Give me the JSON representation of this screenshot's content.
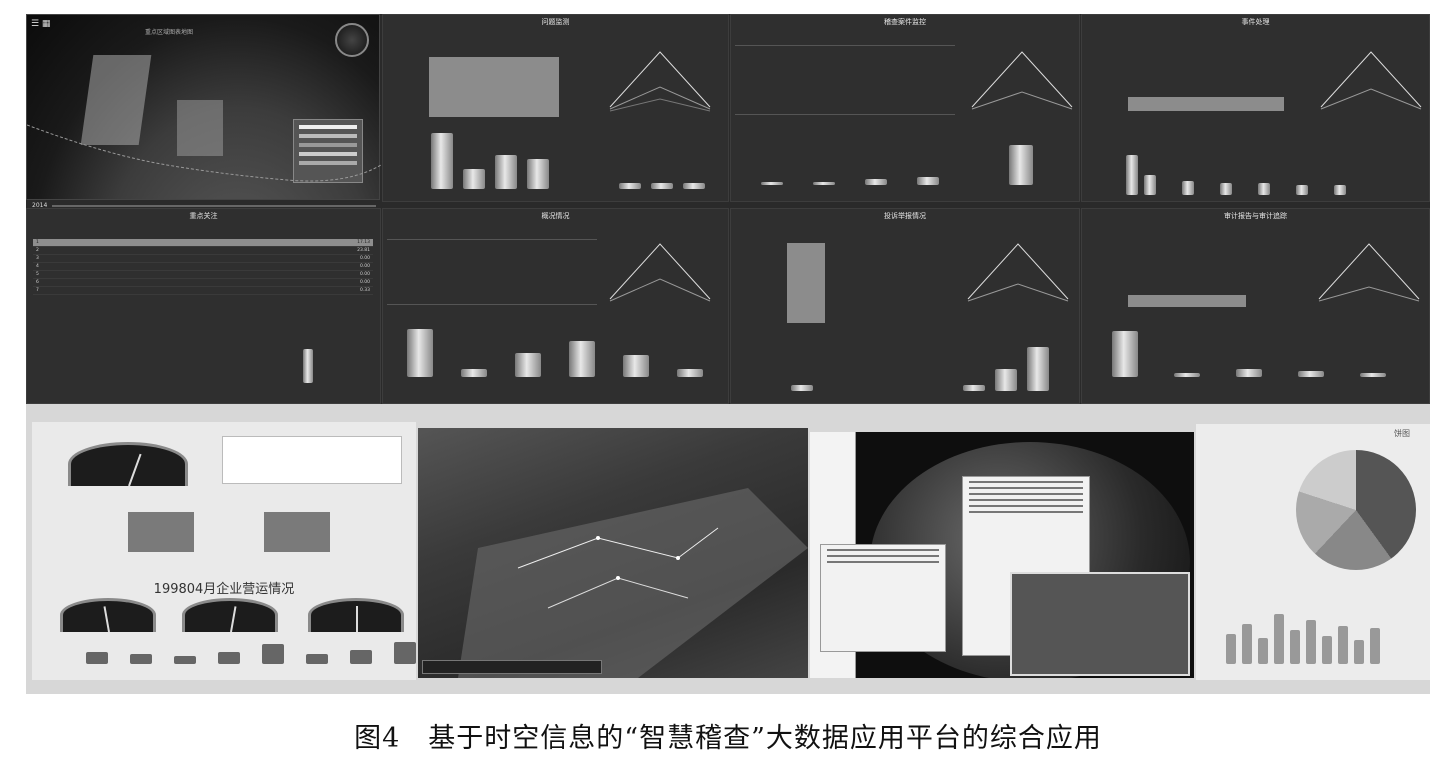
{
  "caption": "图4　基于时空信息的“智慧稽查”大数据应用平台的综合应用",
  "wall": {
    "map_year": "2014",
    "map_title": "重点区域图表地图",
    "panels": [
      {
        "title": "问题监测"
      },
      {
        "title": "稽查案件监控"
      },
      {
        "title": "事件处理"
      },
      {
        "title": "重点关注"
      },
      {
        "title": "概况情况"
      },
      {
        "title": "投诉举报情况"
      },
      {
        "title": "审计报告与审计追踪"
      }
    ],
    "ranking_rows": [
      {
        "rank": "1",
        "value": "17.13"
      },
      {
        "rank": "2",
        "value": "23.81"
      },
      {
        "rank": "3",
        "value": "0.00"
      },
      {
        "rank": "4",
        "value": "0.00"
      },
      {
        "rank": "5",
        "value": "0.00"
      },
      {
        "rank": "6",
        "value": "0.00"
      },
      {
        "rank": "7",
        "value": "0.33"
      }
    ]
  },
  "room": {
    "left_screen_title": "199804月企业营运情况",
    "right_screen_label": "饼图"
  },
  "icons": {
    "gauge": "gauge-icon",
    "globe": "globe-icon"
  }
}
